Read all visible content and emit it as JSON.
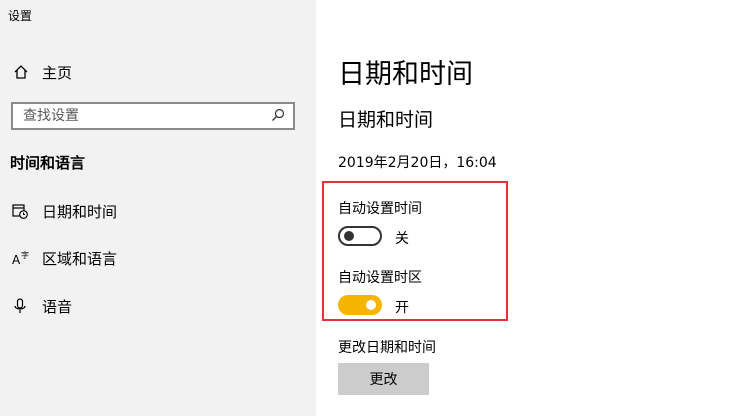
{
  "window": {
    "title": "设置"
  },
  "sidebar": {
    "home": {
      "label": "主页",
      "icon": "home-icon"
    },
    "search": {
      "placeholder": "查找设置",
      "icon": "search-icon"
    },
    "section_title": "时间和语言",
    "items": [
      {
        "label": "日期和时间",
        "icon": "calendar-clock-icon"
      },
      {
        "label": "区域和语言",
        "icon": "language-icon"
      },
      {
        "label": "语音",
        "icon": "microphone-icon"
      }
    ]
  },
  "main": {
    "page_title": "日期和时间",
    "sub_title": "日期和时间",
    "current_datetime": "2019年2月20日，16:04",
    "auto_time": {
      "label": "自动设置时间",
      "state_text": "关",
      "enabled": false
    },
    "auto_timezone": {
      "label": "自动设置时区",
      "state_text": "开",
      "enabled": true
    },
    "change": {
      "label": "更改日期和时间",
      "button": "更改"
    }
  },
  "colors": {
    "accent": "#f4b400",
    "highlight_border": "#e3323a",
    "sidebar_bg": "#f2f2f2",
    "button_bg": "#cccccc"
  }
}
